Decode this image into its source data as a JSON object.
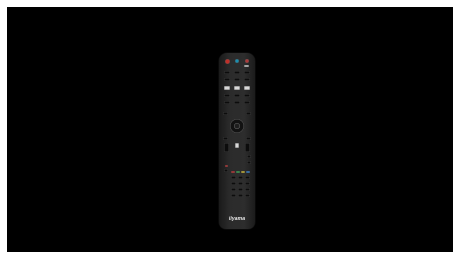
{
  "remote": {
    "brand_logo": "iiyama",
    "colors": {
      "body": "#2b2b2b",
      "background": "#000000",
      "power": "#c0302a",
      "red": "#c42b2b",
      "green": "#2fa64a",
      "yellow": "#d8c12c",
      "blue": "#2b7fd1"
    }
  }
}
